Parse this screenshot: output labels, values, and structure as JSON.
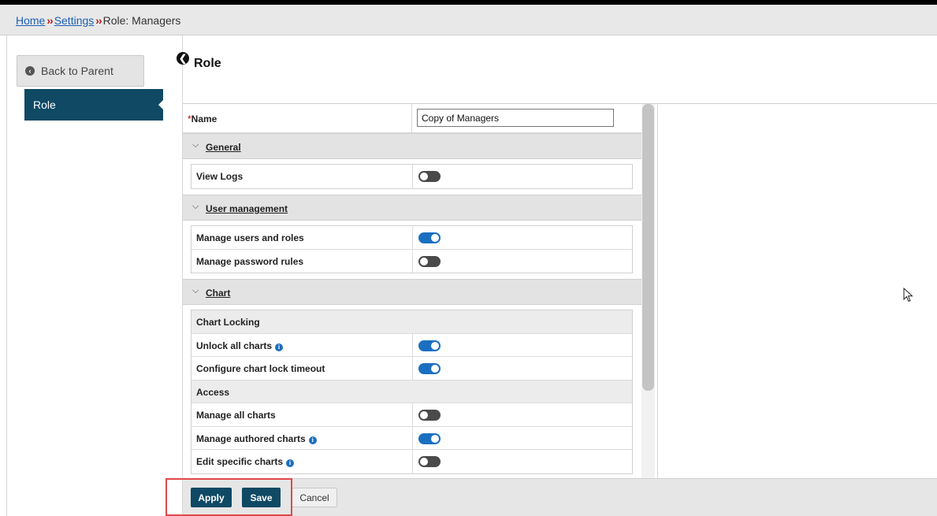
{
  "breadcrumb": {
    "home": "Home",
    "settings": "Settings",
    "sep": "››",
    "current": "Role: Managers"
  },
  "sidebar": {
    "back_label": "Back to Parent",
    "active_tab": "Role"
  },
  "main": {
    "title": "Role"
  },
  "form": {
    "name_required_mark": "*",
    "name_label": "Name",
    "name_value": "Copy of Managers"
  },
  "sections": {
    "general": {
      "title": "General",
      "rows": [
        {
          "label": "View Logs",
          "enabled": false
        }
      ]
    },
    "user_management": {
      "title": "User management",
      "rows": [
        {
          "label": "Manage users and roles",
          "enabled": true
        },
        {
          "label": "Manage password rules",
          "enabled": false
        }
      ]
    },
    "chart": {
      "title": "Chart",
      "groups": {
        "chart_locking": "Chart Locking",
        "access": "Access"
      },
      "rows": [
        {
          "label": "Unlock all charts",
          "enabled": true,
          "info": true
        },
        {
          "label": "Configure chart lock timeout",
          "enabled": true,
          "info": false
        },
        {
          "label": "Manage all charts",
          "enabled": false,
          "info": false
        },
        {
          "label": "Manage authored charts",
          "enabled": true,
          "info": true
        },
        {
          "label": "Edit specific charts",
          "enabled": false,
          "info": true
        }
      ]
    }
  },
  "footer": {
    "apply": "Apply",
    "save": "Save",
    "cancel": "Cancel"
  },
  "icons": {
    "chevron": "⌵",
    "info": "i",
    "back_circle": "❮"
  },
  "colors": {
    "primary": "#0f4964",
    "toggle_on": "#1b6fc1",
    "toggle_off": "#4a4a4a",
    "highlight": "#e04848",
    "link": "#1a5fb4"
  }
}
